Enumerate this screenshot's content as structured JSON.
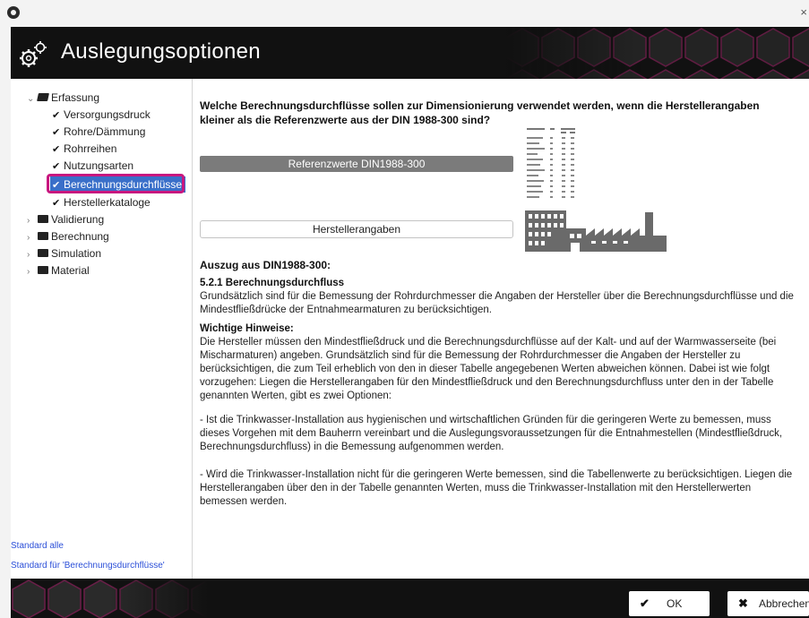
{
  "window": {
    "close_glyph": "×",
    "app_icon": "app-logo-icon"
  },
  "header": {
    "title": "Auslegungsoptionen",
    "icon": "gears-icon"
  },
  "sidebar": {
    "tree": [
      {
        "label": "Erfassung",
        "expanded": true
      },
      {
        "label": "Versorgungsdruck",
        "checked": true
      },
      {
        "label": "Rohre/Dämmung",
        "checked": true
      },
      {
        "label": "Rohrreihen",
        "checked": true
      },
      {
        "label": "Nutzungsarten",
        "checked": true
      },
      {
        "label": "Berechnungsdurchflüsse",
        "checked": true,
        "selected": true
      },
      {
        "label": "Herstellerkataloge",
        "checked": true
      },
      {
        "label": "Validierung",
        "expanded": false
      },
      {
        "label": "Berechnung",
        "expanded": false
      },
      {
        "label": "Simulation",
        "expanded": false
      },
      {
        "label": "Material",
        "expanded": false
      }
    ],
    "link_all": "Standard alle",
    "link_current": "Standard für 'Berechnungsdurchflüsse'"
  },
  "main": {
    "question": "Welche Berechnungsdurchflüsse sollen zur Dimensionierung verwendet werden, wenn die Herstellerangaben kleiner als die Referenzwerte aus der DIN 1988-300 sind?",
    "option_reference": "Referenzwerte DIN1988-300",
    "option_manufacturer": "Herstellerangaben",
    "excerpt_title": "Auszug aus DIN1988-300:",
    "section_heading": "5.2.1 Berechnungsdurchfluss",
    "section_text": "Grundsätzlich sind für die Bemessung der Rohrdurchmesser die Angaben der Hersteller über die Berechnungsdurchflüsse und die Mindestfließdrücke der Entnahmearmaturen zu berücksichtigen.",
    "notes_heading": "Wichtige Hinweise:",
    "notes_text": "Die Hersteller müssen den Mindestfließdruck und die Berechnungsdurchflüsse auf der Kalt- und auf der Warmwasserseite (bei Mischarmaturen) angeben. Grundsätzlich sind für die Bemessung der Rohrdurchmesser die Angaben der Hersteller zu berücksichtigen, die zum Teil erheblich von den in dieser Tabelle angegebenen Werten abweichen können. Dabei ist wie folgt vorzugehen: Liegen die Herstellerangaben für den Mindestfließdruck und den Berechnungsdurchfluss unter den in der Tabelle genannten Werten, gibt es zwei Optionen:",
    "option1_text": "- Ist die Trinkwasser-Installation aus hygienischen und wirtschaftlichen Gründen für die geringeren Werte zu bemessen, muss dieses Vorgehen mit dem Bauherrn vereinbart und die Auslegungsvoraussetzungen für die Entnahmestellen (Mindestfließdruck, Berechnungsdurchfluss) in die Bemessung aufgenommen werden.",
    "option2_text": "- Wird die Trinkwasser-Installation nicht für die geringeren Werte bemessen, sind die Tabellenwerte zu berücksichtigen. Liegen die Herstellerangaben über den in der Tabelle genannten Werten, muss die Trinkwasser-Installation mit den Herstellerwerten bemessen werden."
  },
  "footer": {
    "ok_label": "OK",
    "cancel_label": "Abbrechen"
  },
  "colors": {
    "accent": "#c8177f",
    "selection": "#3a6fc9",
    "link": "#2b4fd8",
    "header_bg": "#111111"
  }
}
